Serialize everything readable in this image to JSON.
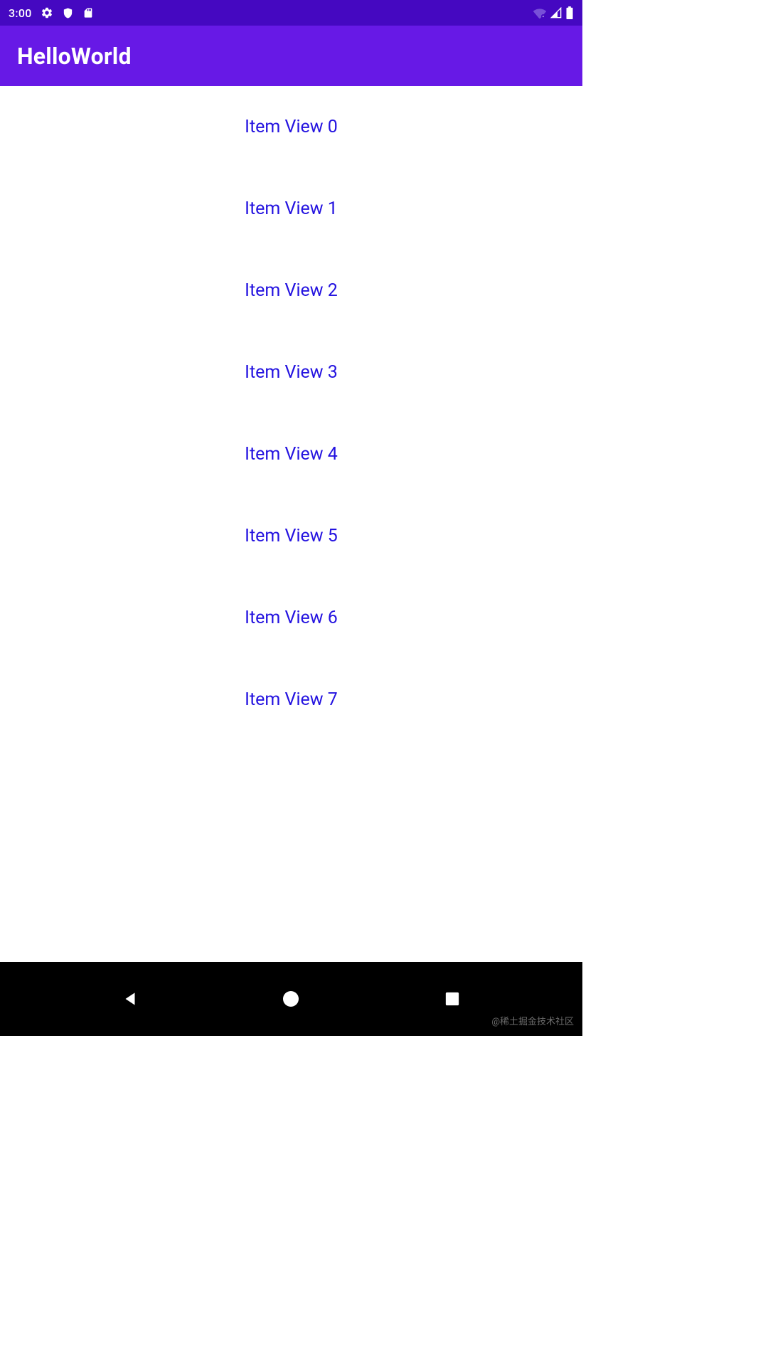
{
  "status": {
    "time": "3:00"
  },
  "app": {
    "title": "HelloWorld"
  },
  "list": {
    "items": [
      {
        "label": "Item View 0"
      },
      {
        "label": "Item View 1"
      },
      {
        "label": "Item View 2"
      },
      {
        "label": "Item View 3"
      },
      {
        "label": "Item View 4"
      },
      {
        "label": "Item View 5"
      },
      {
        "label": "Item View 6"
      },
      {
        "label": "Item View 7"
      }
    ]
  },
  "watermark": "@稀土掘金技术社区",
  "colors": {
    "statusBar": "#4508c1",
    "actionBar": "#6719e6",
    "itemText": "#2413e0",
    "navBar": "#000000"
  }
}
